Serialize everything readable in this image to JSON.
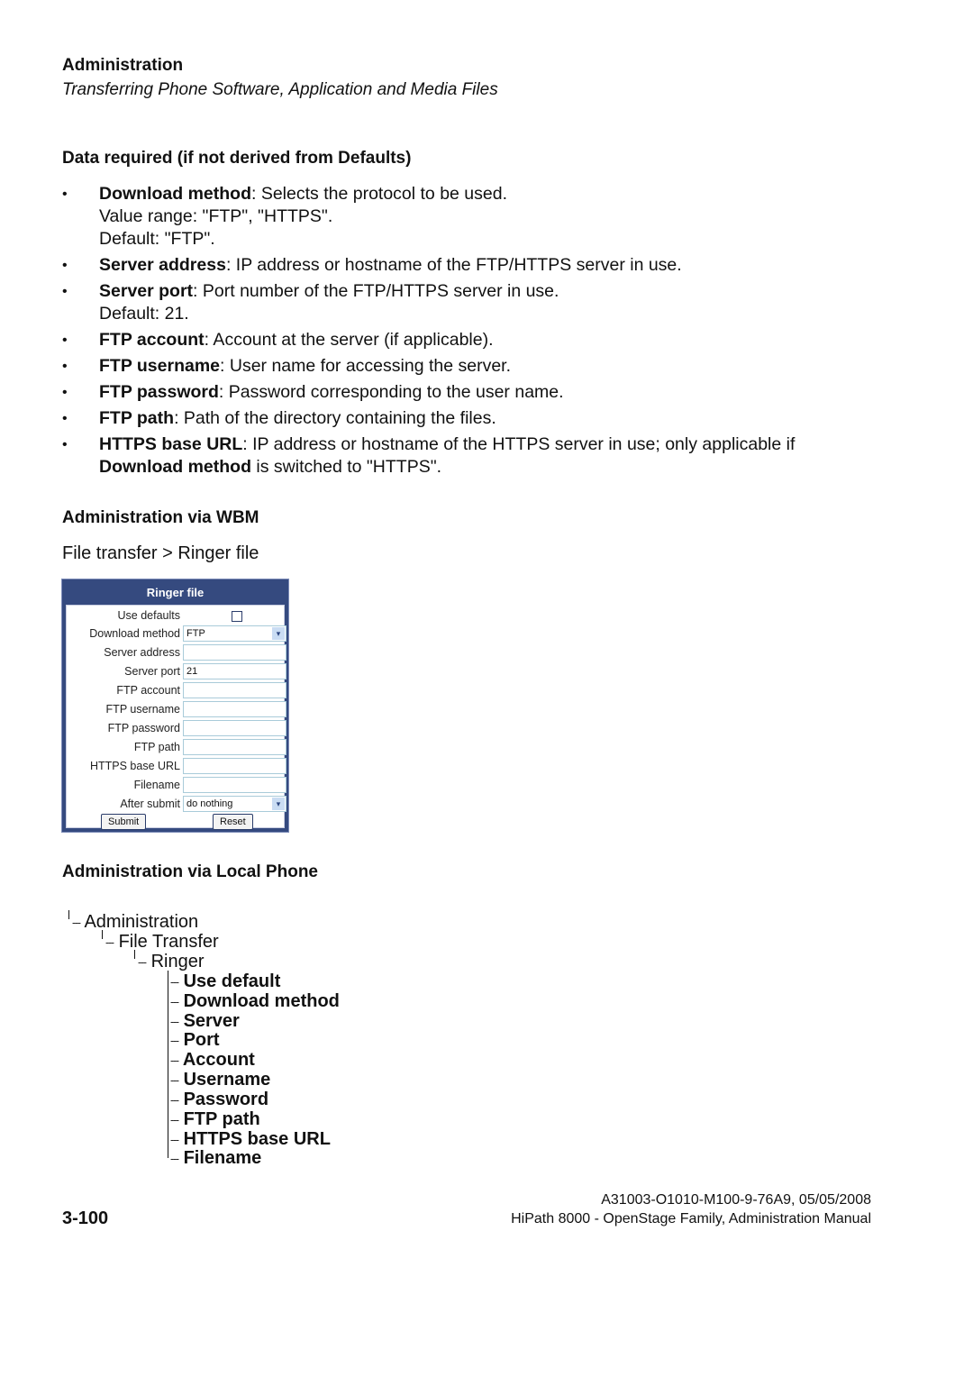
{
  "header": {
    "section": "Administration",
    "subtitle": "Transferring Phone Software, Application and Media Files"
  },
  "data_required": {
    "heading": "Data required (if not derived from Defaults)",
    "items": [
      {
        "term": "Download method",
        "desc": ": Selects the protocol to be used.",
        "extra": [
          "Value range: \"FTP\", \"HTTPS\".",
          "Default: \"FTP\"."
        ]
      },
      {
        "term": "Server address",
        "desc": ": IP address or hostname of the FTP/HTTPS server in use.",
        "extra": []
      },
      {
        "term": "Server port",
        "desc": ": Port number of the FTP/HTTPS server in use.",
        "extra": [
          "Default: 21."
        ]
      },
      {
        "term": "FTP account",
        "desc": ": Account at the server (if applicable).",
        "extra": []
      },
      {
        "term": "FTP username",
        "desc": ": User name for accessing the server.",
        "extra": []
      },
      {
        "term": "FTP password",
        "desc": ": Password corresponding to the user name.",
        "extra": []
      },
      {
        "term": "FTP path",
        "desc": ": Path of the directory containing the files.",
        "extra": []
      },
      {
        "term": "HTTPS base URL",
        "desc": ": IP address or hostname of the HTTPS server in use; only applicable if",
        "extra2_term": "Download method",
        "extra2_desc": " is switched to \"HTTPS\"."
      }
    ],
    "bullet_glyph": "•"
  },
  "wbm": {
    "heading": "Administration via WBM",
    "path": "File transfer > Ringer file",
    "form": {
      "title": "Ringer file",
      "use_defaults_label": "Use defaults",
      "use_defaults_checked": false,
      "download_method_label": "Download method",
      "download_method_value": "FTP",
      "server_address_label": "Server address",
      "server_address_value": "",
      "server_port_label": "Server port",
      "server_port_value": "21",
      "ftp_account_label": "FTP account",
      "ftp_account_value": "",
      "ftp_username_label": "FTP username",
      "ftp_username_value": "",
      "ftp_password_label": "FTP password",
      "ftp_password_value": "",
      "ftp_path_label": "FTP path",
      "ftp_path_value": "",
      "https_base_url_label": "HTTPS base URL",
      "https_base_url_value": "",
      "filename_label": "Filename",
      "filename_value": "",
      "after_submit_label": "After submit",
      "after_submit_value": "do nothing",
      "submit_label": "Submit",
      "reset_label": "Reset",
      "dropdown_glyph": "▾",
      "colors": {
        "frame": "#354a7f",
        "field_border": "#a9cbd9",
        "dropdown_button": "#c9dcf3"
      }
    }
  },
  "local_phone": {
    "heading": "Administration via Local Phone",
    "tree": {
      "level1": "Administration",
      "level2": "File Transfer",
      "level3": "Ringer",
      "leaf_prefix": "---",
      "leaves": [
        "Use default",
        "Download method",
        "Server",
        "Port",
        "Account",
        "Username",
        "Password",
        "FTP path",
        "HTTPS base URL",
        "Filename"
      ]
    }
  },
  "footer": {
    "page_number": "3-100",
    "doc_code": "A31003-O1010-M100-9-76A9, 05/05/2008",
    "manual_title": "HiPath 8000 - OpenStage Family, Administration Manual"
  }
}
